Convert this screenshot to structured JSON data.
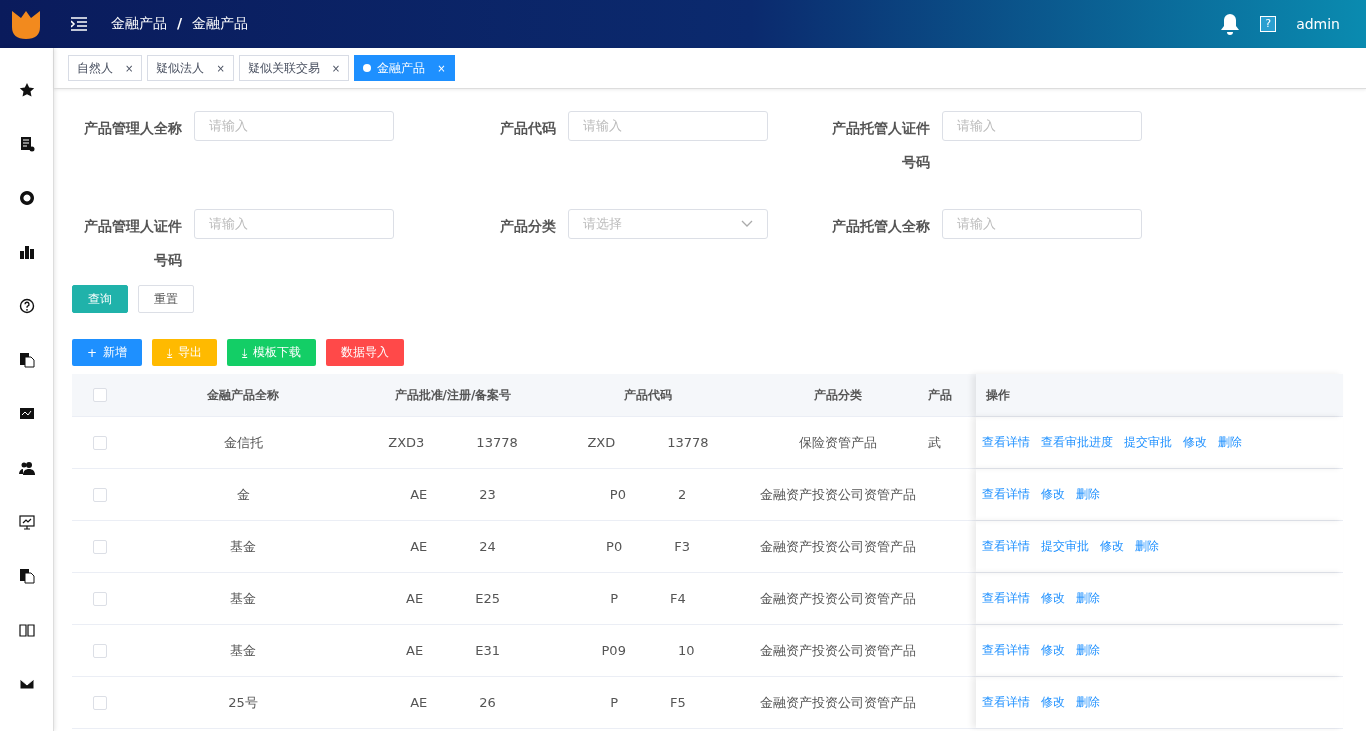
{
  "header": {
    "breadcrumb": [
      "金融产品",
      "金融产品"
    ],
    "separator": "/",
    "user": "admin",
    "help": "?"
  },
  "tabs": [
    {
      "label": "自然人",
      "selected": false,
      "close": "×"
    },
    {
      "label": "疑似法人",
      "selected": false,
      "close": "×"
    },
    {
      "label": "疑似关联交易",
      "selected": false,
      "close": "×"
    },
    {
      "label": "金融产品",
      "selected": true,
      "close": "×"
    }
  ],
  "filters": [
    {
      "label": "产品管理人全称",
      "kind": "input",
      "placeholder": "请输入"
    },
    {
      "label": "产品代码",
      "kind": "input",
      "placeholder": "请输入"
    },
    {
      "label": "产品托管人证件号码",
      "kind": "input",
      "placeholder": "请输入"
    },
    {
      "label": "产品管理人证件号码",
      "kind": "input",
      "placeholder": "请输入"
    },
    {
      "label": "产品分类",
      "kind": "select",
      "placeholder": "请选择"
    },
    {
      "label": "产品托管人全称",
      "kind": "input",
      "placeholder": "请输入"
    }
  ],
  "form_buttons": [
    {
      "label": "查询",
      "kind": "primary"
    },
    {
      "label": "重置",
      "kind": "plain"
    }
  ],
  "toolbar": [
    {
      "label": "新增",
      "icon": "+",
      "color": "#1e90ff"
    },
    {
      "label": "导出",
      "icon": "⤓",
      "color": "#ffba00"
    },
    {
      "label": "模板下载",
      "icon": "⤓",
      "color": "#13ce66"
    },
    {
      "label": "数据导入",
      "color": "#ff4949"
    }
  ],
  "table": {
    "select_all_checked": false,
    "columns": [
      "金融产品全称",
      "产品批准/注册/备案号",
      "产品代码",
      "产品分类",
      "产品",
      "操作"
    ],
    "rows": [
      {
        "checked": false,
        "name": [
          "金信托"
        ],
        "reg": [
          "ZXD3",
          "13778"
        ],
        "code": [
          "ZXD",
          "13778"
        ],
        "category": "保险资管产品",
        "column_5": "武",
        "actions": [
          "查看详情",
          "查看审批进度",
          "提交审批",
          "修改",
          "删除"
        ]
      },
      {
        "checked": false,
        "name": [
          "金"
        ],
        "reg": [
          "AE",
          "23"
        ],
        "code": [
          "P0",
          "2"
        ],
        "category": "金融资产投资公司资管产品",
        "actions": [
          "查看详情",
          "修改",
          "删除"
        ]
      },
      {
        "checked": false,
        "name": [
          "基金"
        ],
        "reg": [
          "AE",
          "24"
        ],
        "code": [
          "P0",
          "F3"
        ],
        "category": "金融资产投资公司资管产品",
        "actions": [
          "查看详情",
          "提交审批",
          "修改",
          "删除"
        ]
      },
      {
        "checked": false,
        "name": [
          "基金"
        ],
        "reg": [
          "AE",
          "E25"
        ],
        "code": [
          "P",
          "F4"
        ],
        "category": "金融资产投资公司资管产品",
        "actions": [
          "查看详情",
          "修改",
          "删除"
        ]
      },
      {
        "checked": false,
        "name": [
          "基金"
        ],
        "reg": [
          "AE",
          "E31"
        ],
        "code": [
          "P09",
          "10"
        ],
        "category": "金融资产投资公司资管产品",
        "actions": [
          "查看详情",
          "修改",
          "删除"
        ]
      },
      {
        "checked": false,
        "name": [
          "25号"
        ],
        "reg": [
          "AE",
          "26"
        ],
        "code": [
          "P",
          "F5"
        ],
        "category": "金融资产投资公司资管产品",
        "actions": [
          "查看详情",
          "修改",
          "删除"
        ]
      }
    ]
  }
}
